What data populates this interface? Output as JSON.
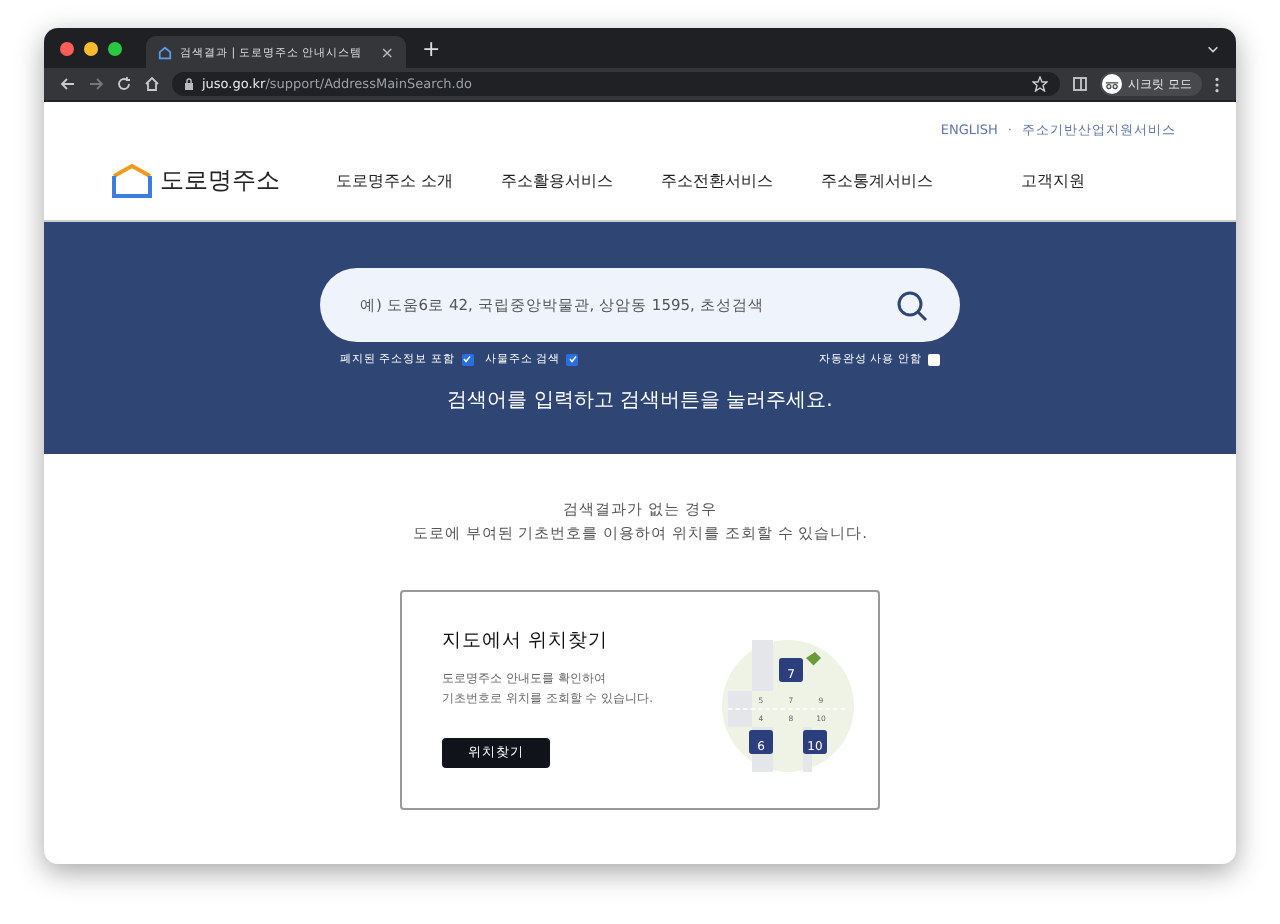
{
  "browser": {
    "tab_title": "검색결과 | 도로명주소 안내시스템",
    "tab_close": "×",
    "new_tab": "+",
    "url": "**juso.go.kr**/support/AddressMainSearch.do",
    "profile": "시크릿 모드"
  },
  "top_links": [
    "ENGLISH",
    "주소기반산업지원서비스"
  ],
  "top_links_separator": "·",
  "logo": "도로명주소",
  "nav": [
    "도로명주소 소개",
    "주소활용서비스",
    "주소전환서비스",
    "주소통계서비스",
    "고객지원"
  ],
  "search": {
    "placeholder": "예) 도움6로 42, 국립중앙박물관, 상암동 1595, 초성검색",
    "options": [
      {
        "label": "폐지된 주소정보 포함",
        "checked": true
      },
      {
        "label": "사물주소 검색",
        "checked": true
      },
      {
        "label": "자동완성 사용 안함",
        "checked": false
      }
    ],
    "hint": "검색어를 입력하고 검색버튼을 눌러주세요."
  },
  "notice": [
    "검색결과가 없는 경우",
    "도로에 부여된 기초번호를 이용하여 위치를 조회할 수 있습니다."
  ],
  "card": {
    "title": "지도에서 위치찾기",
    "description": [
      "도로명주소 안내도를 확인하여",
      "기초번호로 위치를 조회할 수 있습니다."
    ],
    "button": "위치찾기",
    "map": {
      "lot_numbers": [
        "5",
        "7",
        "9",
        "4",
        "8",
        "10"
      ],
      "plates": [
        "7",
        "6",
        "10"
      ]
    }
  }
}
